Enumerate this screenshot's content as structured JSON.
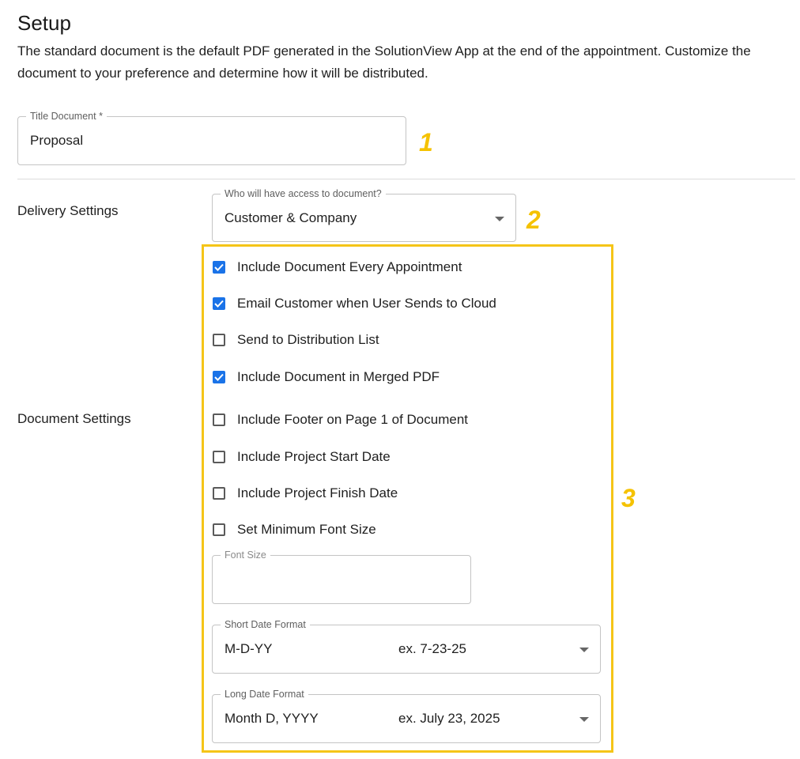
{
  "header": {
    "title": "Setup",
    "description": "The standard document is the default PDF generated in the SolutionView App at the end of the appointment. Customize the document to your preference and determine how it will be distributed."
  },
  "title_field": {
    "label": "Title Document *",
    "value": "Proposal"
  },
  "delivery": {
    "section_label": "Delivery Settings",
    "access_select": {
      "label": "Who will have access to document?",
      "value": "Customer & Company"
    }
  },
  "document": {
    "section_label": "Document Settings"
  },
  "checkboxes": [
    {
      "label": "Include Document Every Appointment",
      "checked": true
    },
    {
      "label": "Email Customer when User Sends to Cloud",
      "checked": true
    },
    {
      "label": "Send to Distribution List",
      "checked": false
    },
    {
      "label": "Include Document in Merged PDF",
      "checked": true
    },
    {
      "label": "Include Footer on Page 1 of Document",
      "checked": false
    },
    {
      "label": "Include Project Start Date",
      "checked": false
    },
    {
      "label": "Include Project Finish Date",
      "checked": false
    },
    {
      "label": "Set Minimum Font Size",
      "checked": false
    }
  ],
  "font_size_field": {
    "label": "Font Size",
    "value": ""
  },
  "short_date_select": {
    "label": "Short Date Format",
    "value": "M-D-YY",
    "example": "ex. 7-23-25"
  },
  "long_date_select": {
    "label": "Long Date Format",
    "value": "Month D, YYYY",
    "example": "ex. July 23, 2025"
  },
  "callouts": {
    "one": "1",
    "two": "2",
    "three": "3"
  },
  "colors": {
    "accent": "#1a73e8",
    "highlight": "#f5c518",
    "callout": "#f5c200"
  }
}
